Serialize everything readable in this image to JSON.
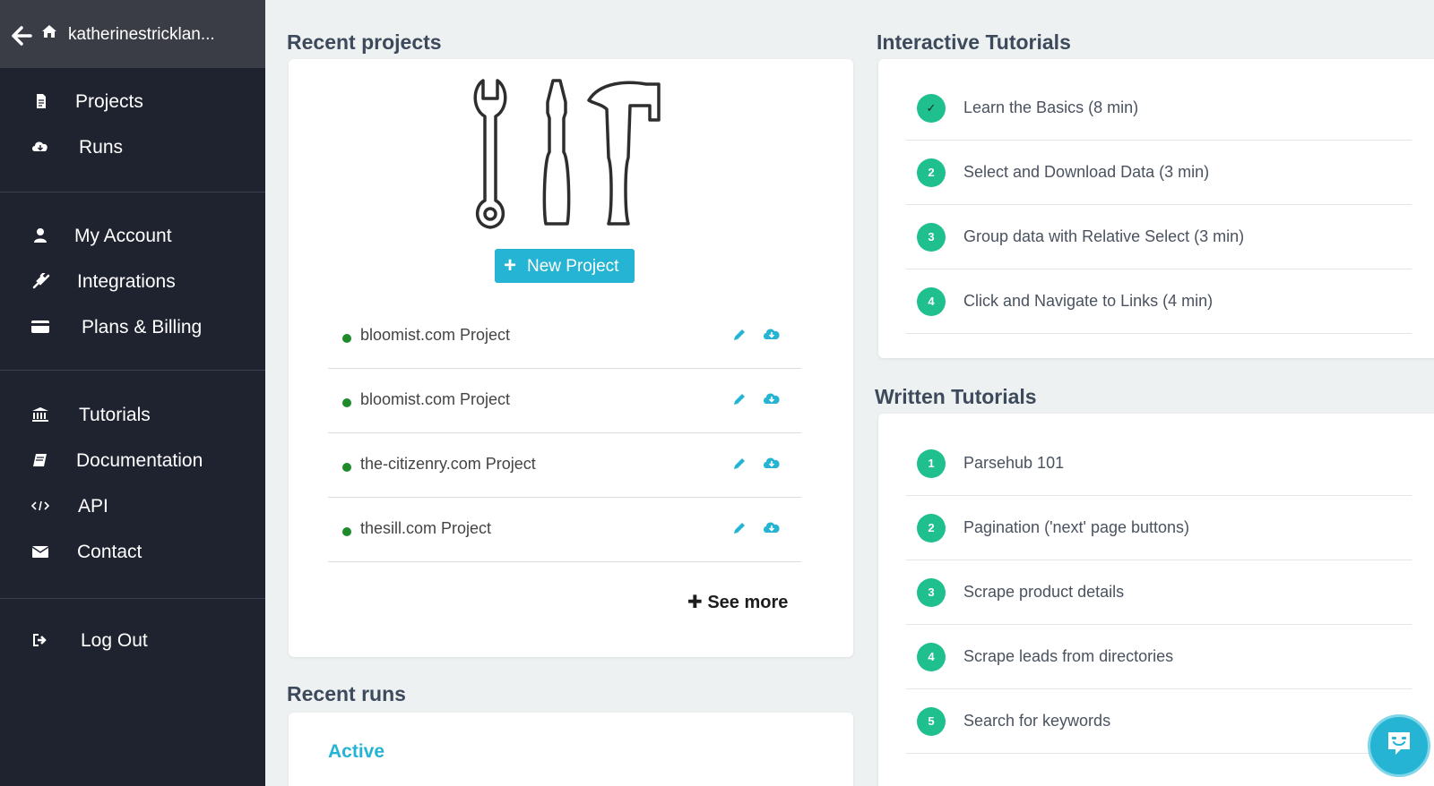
{
  "sidebar": {
    "username": "katherinestricklan...",
    "group1": [
      {
        "label": "Projects",
        "icon": "document-icon"
      },
      {
        "label": "Runs",
        "icon": "cloud-download-icon"
      }
    ],
    "group2": [
      {
        "label": "My Account",
        "icon": "user-icon"
      },
      {
        "label": "Integrations",
        "icon": "plug-icon"
      },
      {
        "label": "Plans & Billing",
        "icon": "credit-card-icon"
      }
    ],
    "group3": [
      {
        "label": "Tutorials",
        "icon": "bank-icon"
      },
      {
        "label": "Documentation",
        "icon": "book-icon"
      },
      {
        "label": "API",
        "icon": "code-icon"
      },
      {
        "label": "Contact",
        "icon": "envelope-icon"
      }
    ],
    "logout": {
      "label": "Log Out",
      "icon": "sign-out-icon"
    }
  },
  "recent_projects": {
    "title": "Recent projects",
    "new_project_label": "New Project",
    "projects": [
      {
        "name": "bloomist.com Project"
      },
      {
        "name": "bloomist.com Project"
      },
      {
        "name": "the-citizenry.com Project"
      },
      {
        "name": "thesill.com Project"
      }
    ],
    "see_more_label": "See more"
  },
  "recent_runs": {
    "title": "Recent runs",
    "active_label": "Active"
  },
  "interactive_tutorials": {
    "title": "Interactive Tutorials",
    "items": [
      {
        "num": "✓",
        "title": "Learn the Basics (8 min)",
        "completed": true
      },
      {
        "num": "2",
        "title": "Select and Download Data (3 min)"
      },
      {
        "num": "3",
        "title": "Group data with Relative Select (3 min)"
      },
      {
        "num": "4",
        "title": "Click and Navigate to Links (4 min)"
      }
    ]
  },
  "written_tutorials": {
    "title": "Written Tutorials",
    "items": [
      {
        "num": "1",
        "title": "Parsehub 101"
      },
      {
        "num": "2",
        "title": "Pagination ('next' page buttons)"
      },
      {
        "num": "3",
        "title": "Scrape product details"
      },
      {
        "num": "4",
        "title": "Scrape leads from directories"
      },
      {
        "num": "5",
        "title": "Search for keywords"
      }
    ]
  },
  "colors": {
    "sidebar_bg": "#1f2330",
    "accent": "#25b4d3",
    "tutorial_badge": "#1fc08e",
    "status_dot": "#1f8a2a"
  }
}
